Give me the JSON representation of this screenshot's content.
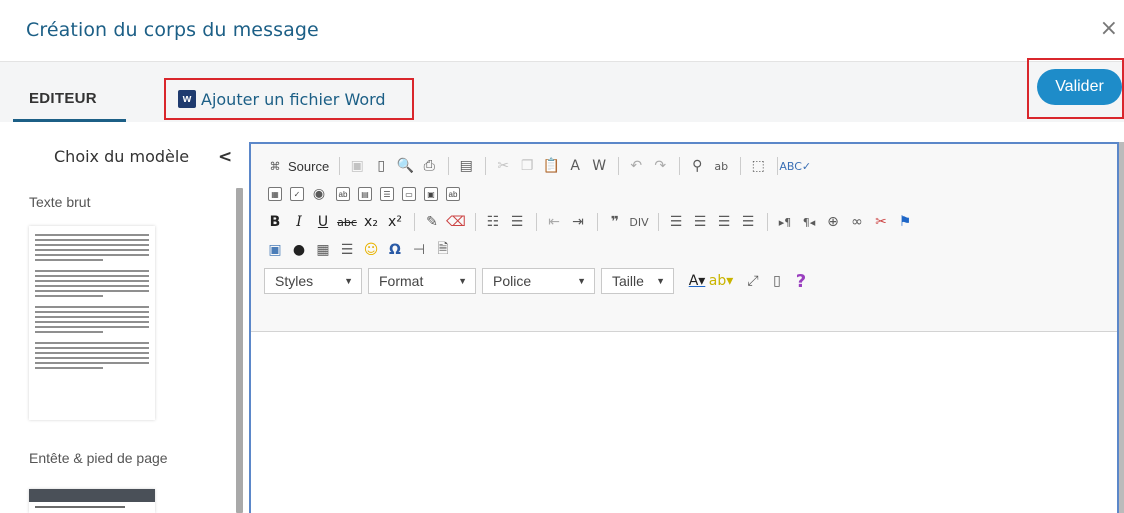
{
  "dialog": {
    "title": "Création du corps du message",
    "close_glyph": "×"
  },
  "tabs": {
    "editeur": "EDITEUR",
    "word": "Ajouter un fichier Word",
    "word_icon_letter": "w"
  },
  "actions": {
    "valider": "Valider"
  },
  "left_panel": {
    "heading": "Choix du modèle",
    "chevron": "<",
    "templates": [
      {
        "label": "Texte brut"
      },
      {
        "label": "Entête & pied de page"
      }
    ]
  },
  "toolbar": {
    "source_label": "Source",
    "combos": [
      {
        "label": "Styles",
        "arrow": "▼"
      },
      {
        "label": "Format",
        "arrow": "▼"
      },
      {
        "label": "Police",
        "arrow": "▼"
      },
      {
        "label": "Taille",
        "arrow": "▼"
      }
    ],
    "help_glyph": "?"
  },
  "colors": {
    "brand": "#1c5f86",
    "button": "#1e8cc9",
    "highlight_border": "#d9262c",
    "editor_border": "#5b87c9"
  }
}
